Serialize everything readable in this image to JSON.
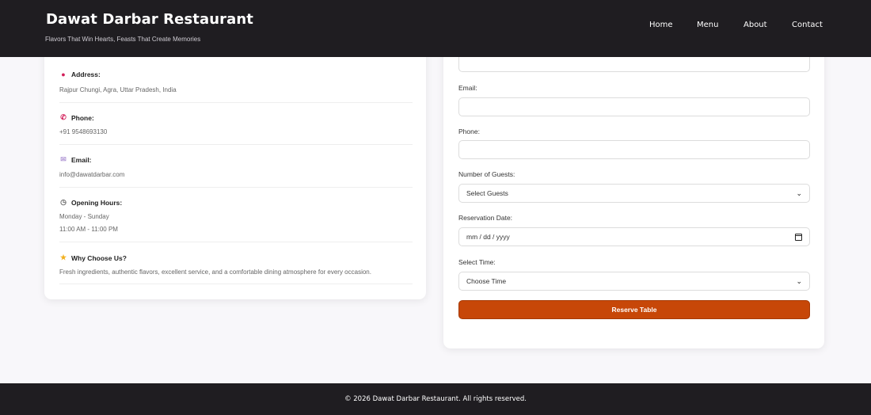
{
  "header": {
    "title": "Dawat Darbar Restaurant",
    "tagline": "Flavors That Win Hearts, Feasts That Create Memories",
    "nav": [
      {
        "label": "Home",
        "name": "nav-home"
      },
      {
        "label": "Menu",
        "name": "nav-menu"
      },
      {
        "label": "About",
        "name": "nav-about"
      },
      {
        "label": "Contact",
        "name": "nav-contact"
      }
    ]
  },
  "info": {
    "address": {
      "icon": "pin-icon",
      "label": "Address:",
      "value": "Rajpur Chungi, Agra, Uttar Pradesh, India"
    },
    "phone": {
      "icon": "phone-icon",
      "label": "Phone:",
      "value": "+91 9548693130"
    },
    "email": {
      "icon": "envelope-icon",
      "label": "Email:",
      "value": "info@dawatdarbar.com"
    },
    "hours": {
      "icon": "clock-icon",
      "label": "Opening Hours:",
      "days": "Monday - Sunday",
      "time": "11:00 AM - 11:00 PM"
    },
    "why": {
      "icon": "star-icon",
      "label": "Why Choose Us?",
      "value": "Fresh ingredients, authentic flavors, excellent service, and a comfortable dining atmosphere for every occasion."
    }
  },
  "form": {
    "email_label": "Email:",
    "phone_label": "Phone:",
    "guests_label": "Number of Guests:",
    "guests_value": "Select Guests",
    "date_label": "Reservation Date:",
    "date_placeholder": "mm / dd / yyyy",
    "time_label": "Select Time:",
    "time_value": "Choose Time",
    "submit_label": "Reserve Table"
  },
  "footer": {
    "copyright": "© 2026 Dawat Darbar Restaurant. All rights reserved."
  },
  "colors": {
    "header_bg": "#1f1d21",
    "accent": "#c74708",
    "page_bg": "#f8f7fa"
  }
}
